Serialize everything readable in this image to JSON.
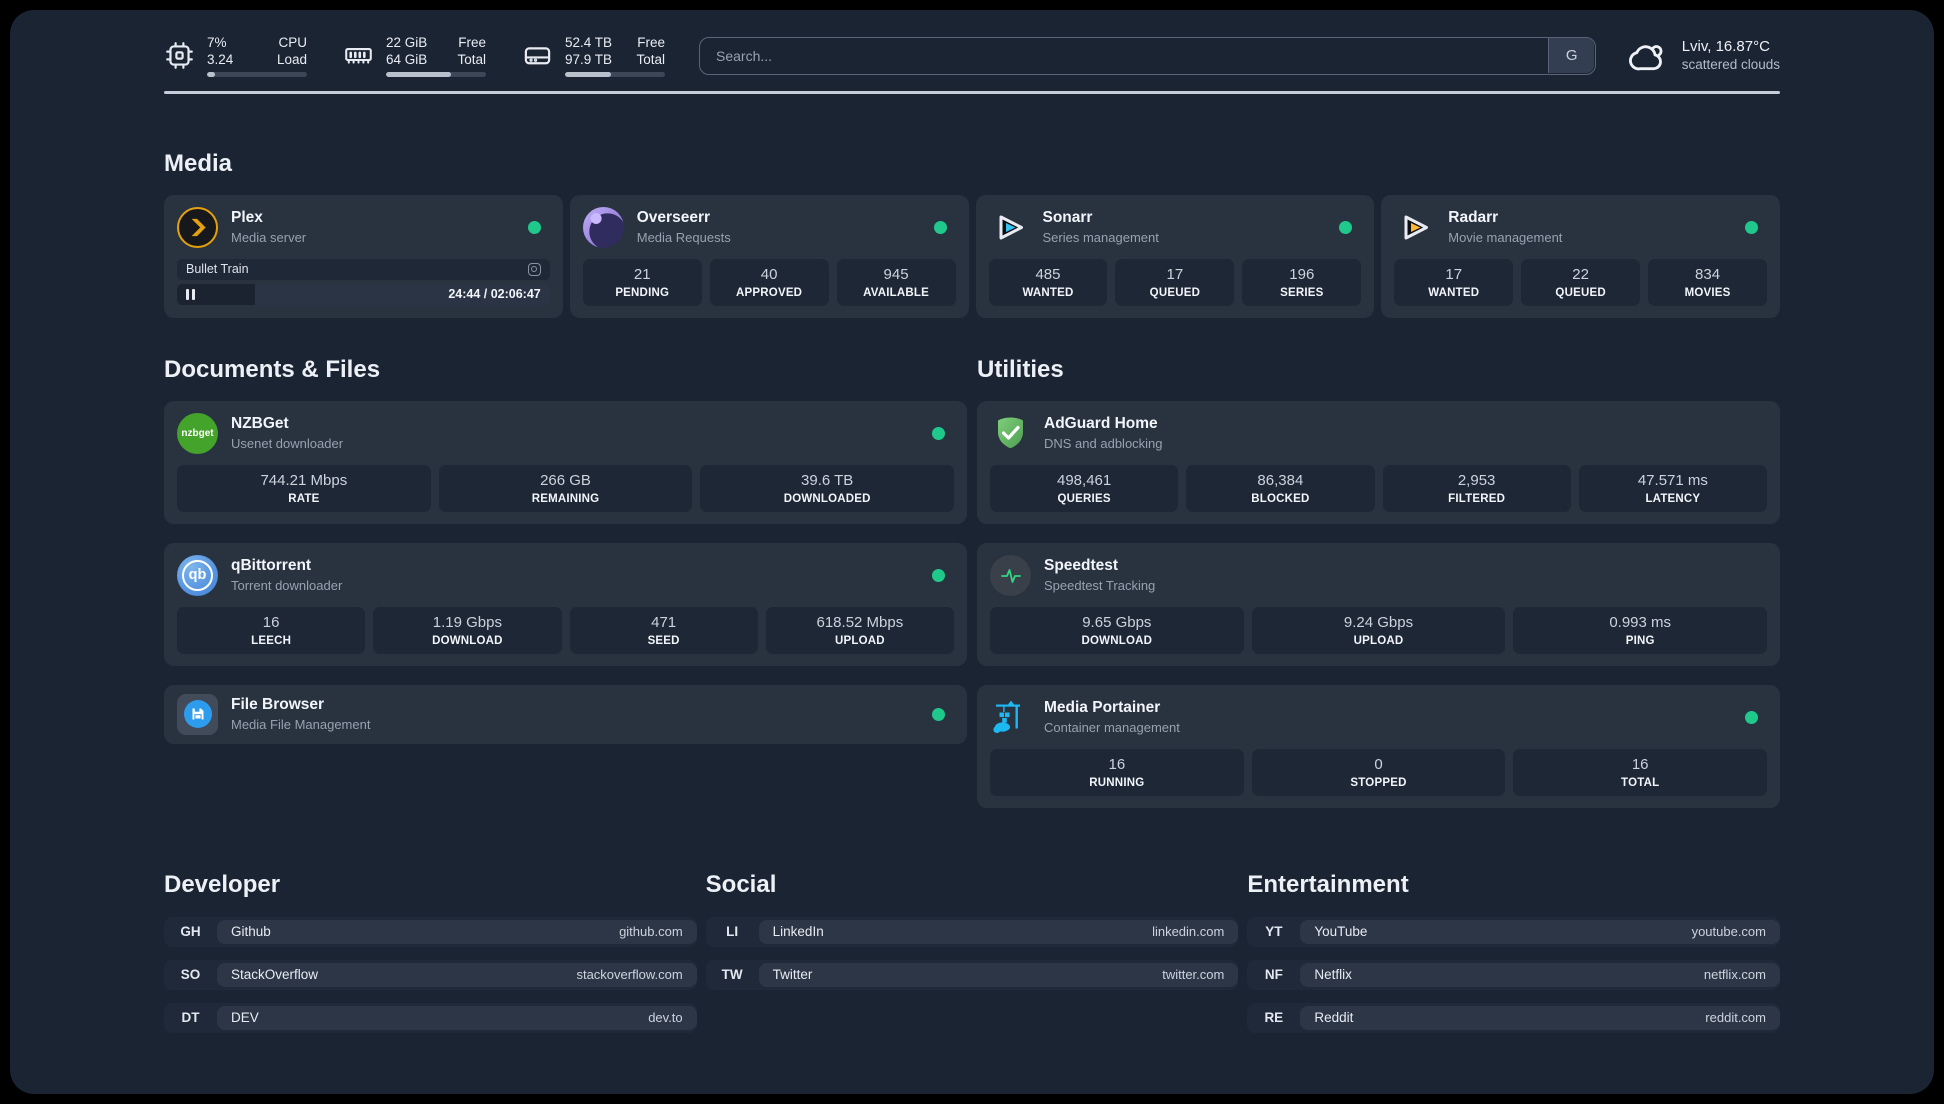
{
  "header": {
    "resources": [
      {
        "name": "cpu",
        "values": [
          "7%",
          "3.24"
        ],
        "labels": [
          "CPU",
          "Load"
        ],
        "progress": 8
      },
      {
        "name": "memory",
        "values": [
          "22 GiB",
          "64 GiB"
        ],
        "labels": [
          "Free",
          "Total"
        ],
        "progress": 65
      },
      {
        "name": "disk",
        "values": [
          "52.4 TB",
          "97.9 TB"
        ],
        "labels": [
          "Free",
          "Total"
        ],
        "progress": 46
      }
    ],
    "search": {
      "placeholder": "Search...",
      "button_label": "G"
    },
    "weather": {
      "location": "Lviv, 16.87°C",
      "condition": "scattered clouds"
    }
  },
  "media": {
    "title": "Media",
    "plex": {
      "name": "Plex",
      "description": "Media server",
      "status": "online",
      "now_playing": {
        "title": "Bullet Train",
        "time_display": "24:44 / 02:06:47",
        "progress_percent": 21
      }
    },
    "overseerr": {
      "name": "Overseerr",
      "description": "Media Requests",
      "status": "online",
      "stats": [
        {
          "value": "21",
          "label": "PENDING"
        },
        {
          "value": "40",
          "label": "APPROVED"
        },
        {
          "value": "945",
          "label": "AVAILABLE"
        }
      ]
    },
    "sonarr": {
      "name": "Sonarr",
      "description": "Series management",
      "status": "online",
      "stats": [
        {
          "value": "485",
          "label": "WANTED"
        },
        {
          "value": "17",
          "label": "QUEUED"
        },
        {
          "value": "196",
          "label": "SERIES"
        }
      ]
    },
    "radarr": {
      "name": "Radarr",
      "description": "Movie management",
      "status": "online",
      "stats": [
        {
          "value": "17",
          "label": "WANTED"
        },
        {
          "value": "22",
          "label": "QUEUED"
        },
        {
          "value": "834",
          "label": "MOVIES"
        }
      ]
    }
  },
  "documents": {
    "title": "Documents & Files",
    "nzbget": {
      "name": "NZBGet",
      "description": "Usenet downloader",
      "status": "online",
      "icon_text": "nzbget",
      "stats": [
        {
          "value": "744.21 Mbps",
          "label": "RATE"
        },
        {
          "value": "266 GB",
          "label": "REMAINING"
        },
        {
          "value": "39.6 TB",
          "label": "DOWNLOADED"
        }
      ]
    },
    "qbittorrent": {
      "name": "qBittorrent",
      "description": "Torrent downloader",
      "status": "online",
      "icon_text": "qb",
      "stats": [
        {
          "value": "16",
          "label": "LEECH"
        },
        {
          "value": "1.19 Gbps",
          "label": "DOWNLOAD"
        },
        {
          "value": "471",
          "label": "SEED"
        },
        {
          "value": "618.52 Mbps",
          "label": "UPLOAD"
        }
      ]
    },
    "filebrowser": {
      "name": "File Browser",
      "description": "Media File Management",
      "status": "online"
    }
  },
  "utilities": {
    "title": "Utilities",
    "adguard": {
      "name": "AdGuard Home",
      "description": "DNS and adblocking",
      "stats": [
        {
          "value": "498,461",
          "label": "QUERIES"
        },
        {
          "value": "86,384",
          "label": "BLOCKED"
        },
        {
          "value": "2,953",
          "label": "FILTERED"
        },
        {
          "value": "47.571 ms",
          "label": "LATENCY"
        }
      ]
    },
    "speedtest": {
      "name": "Speedtest",
      "description": "Speedtest Tracking",
      "stats": [
        {
          "value": "9.65 Gbps",
          "label": "DOWNLOAD"
        },
        {
          "value": "9.24 Gbps",
          "label": "UPLOAD"
        },
        {
          "value": "0.993 ms",
          "label": "PING"
        }
      ]
    },
    "portainer": {
      "name": "Media Portainer",
      "description": "Container management",
      "status": "online",
      "stats": [
        {
          "value": "16",
          "label": "RUNNING"
        },
        {
          "value": "0",
          "label": "STOPPED"
        },
        {
          "value": "16",
          "label": "TOTAL"
        }
      ]
    }
  },
  "bookmarks": [
    {
      "title": "Developer",
      "links": [
        {
          "abbr": "GH",
          "name": "Github",
          "url": "github.com"
        },
        {
          "abbr": "SO",
          "name": "StackOverflow",
          "url": "stackoverflow.com"
        },
        {
          "abbr": "DT",
          "name": "DEV",
          "url": "dev.to"
        }
      ]
    },
    {
      "title": "Social",
      "links": [
        {
          "abbr": "LI",
          "name": "LinkedIn",
          "url": "linkedin.com"
        },
        {
          "abbr": "TW",
          "name": "Twitter",
          "url": "twitter.com"
        }
      ]
    },
    {
      "title": "Entertainment",
      "links": [
        {
          "abbr": "YT",
          "name": "YouTube",
          "url": "youtube.com"
        },
        {
          "abbr": "NF",
          "name": "Netflix",
          "url": "netflix.com"
        },
        {
          "abbr": "RE",
          "name": "Reddit",
          "url": "reddit.com"
        }
      ]
    }
  ],
  "colors": {
    "status_online": "#1fc98b",
    "plex_gold": "#e5a00d",
    "sonarr_blue": "#36c3f1",
    "radarr_yellow": "#fdb52e",
    "nzbget_green": "#44a32a",
    "qbittorrent_blue": "#3d7dd8",
    "adguard_green": "#68bc71",
    "speedtest_pulse": "#32d583",
    "portainer_blue": "#1db8f2",
    "filebrowser_blue": "#2e9ced"
  }
}
